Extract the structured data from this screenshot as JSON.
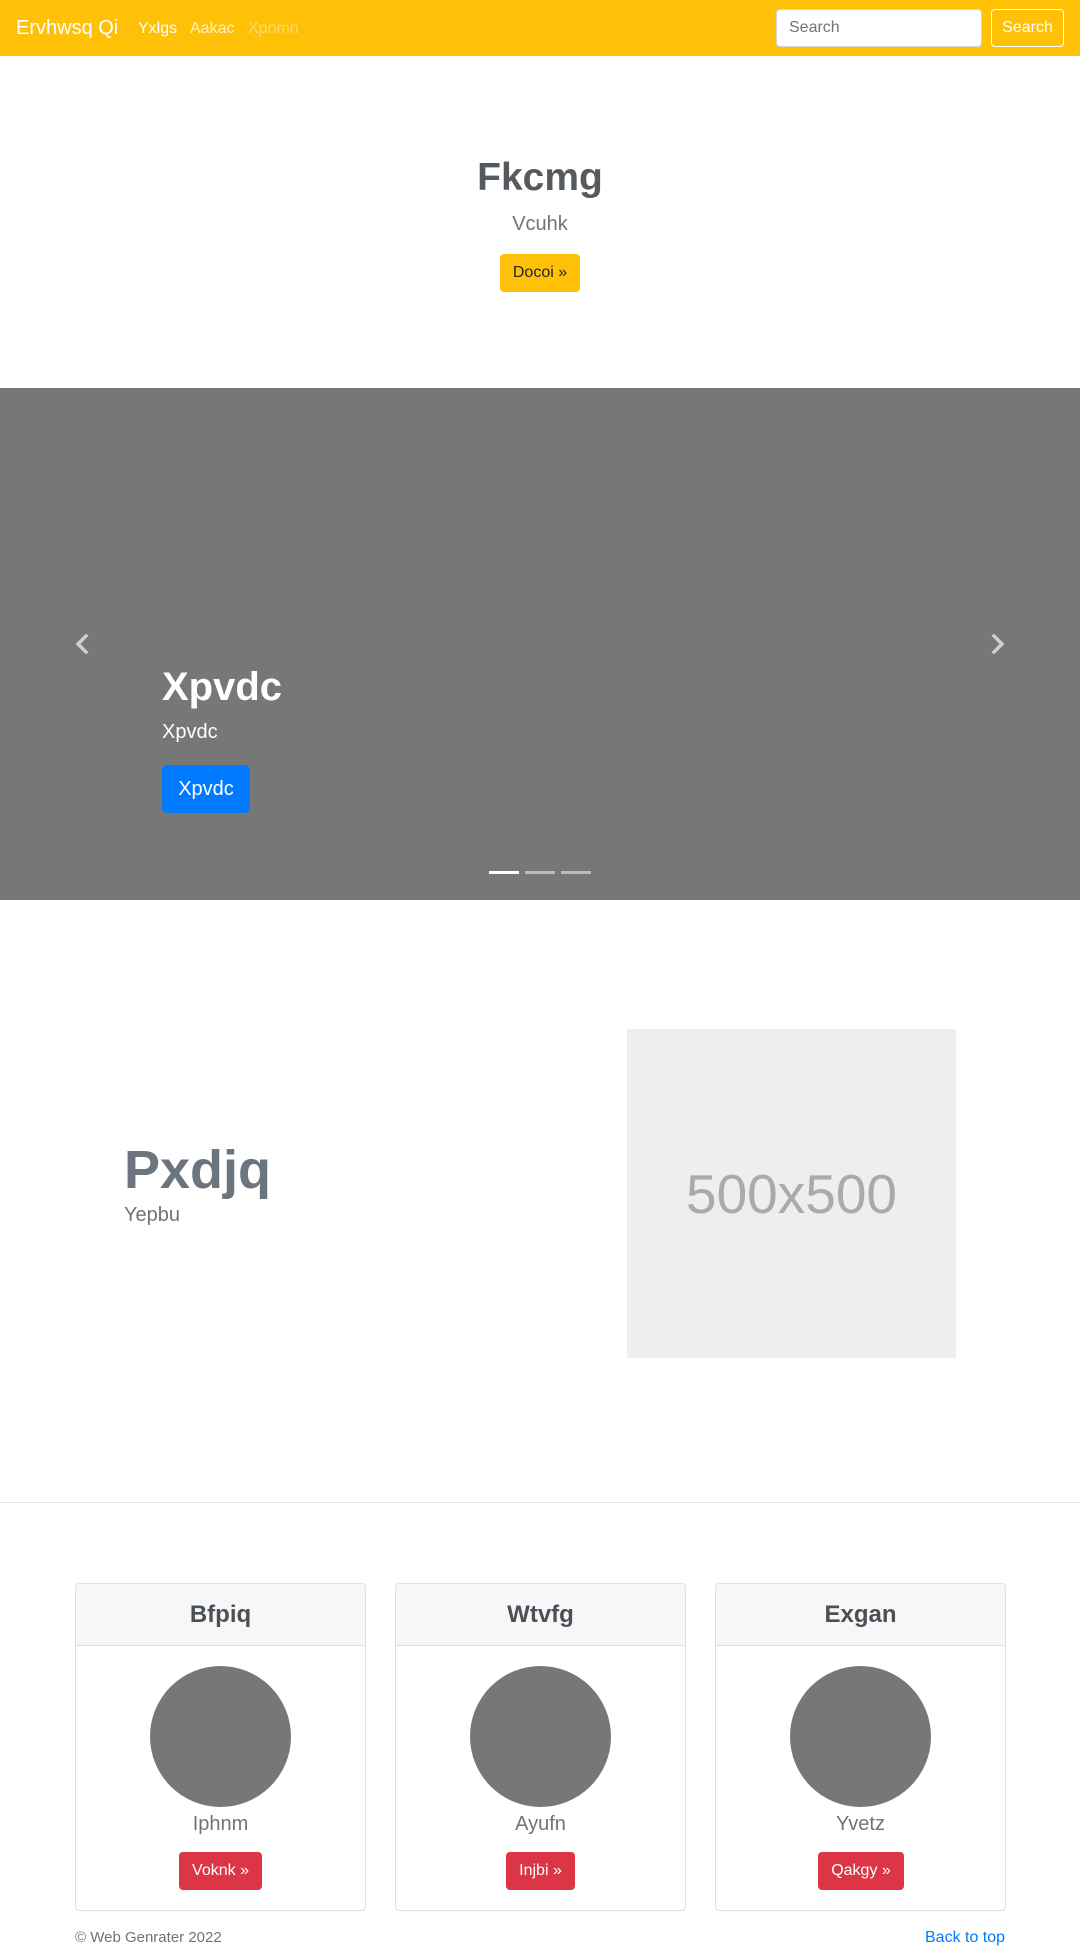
{
  "navbar": {
    "brand": "Ervhwsq Qi",
    "links": [
      "Yxlgs",
      "Aakac",
      "Xpnmn"
    ],
    "search_placeholder": "Search",
    "search_button": "Search",
    "bg_color": "#ffc107"
  },
  "hero": {
    "title": "Fkcmg",
    "subtitle": "Vcuhk",
    "button": "Docoi »"
  },
  "carousel": {
    "title": "Xpvdc",
    "subtitle": "Xpvdc",
    "button": "Xpvdc",
    "slide_count": 3,
    "active_slide": 1,
    "prev_icon": "chevron-left-icon",
    "next_icon": "chevron-right-icon"
  },
  "feature": {
    "title": "Pxdjq",
    "subtitle": "Yepbu",
    "image_label": "500x500"
  },
  "cards": [
    {
      "header": "Bfpiq",
      "name": "Iphnm",
      "button": "Voknk »"
    },
    {
      "header": "Wtvfg",
      "name": "Ayufn",
      "button": "Injbi »"
    },
    {
      "header": "Exgan",
      "name": "Yvetz",
      "button": "Qakgy »"
    }
  ],
  "footer": {
    "copyright": "© Web Genrater 2022",
    "back_to_top": "Back to top"
  }
}
